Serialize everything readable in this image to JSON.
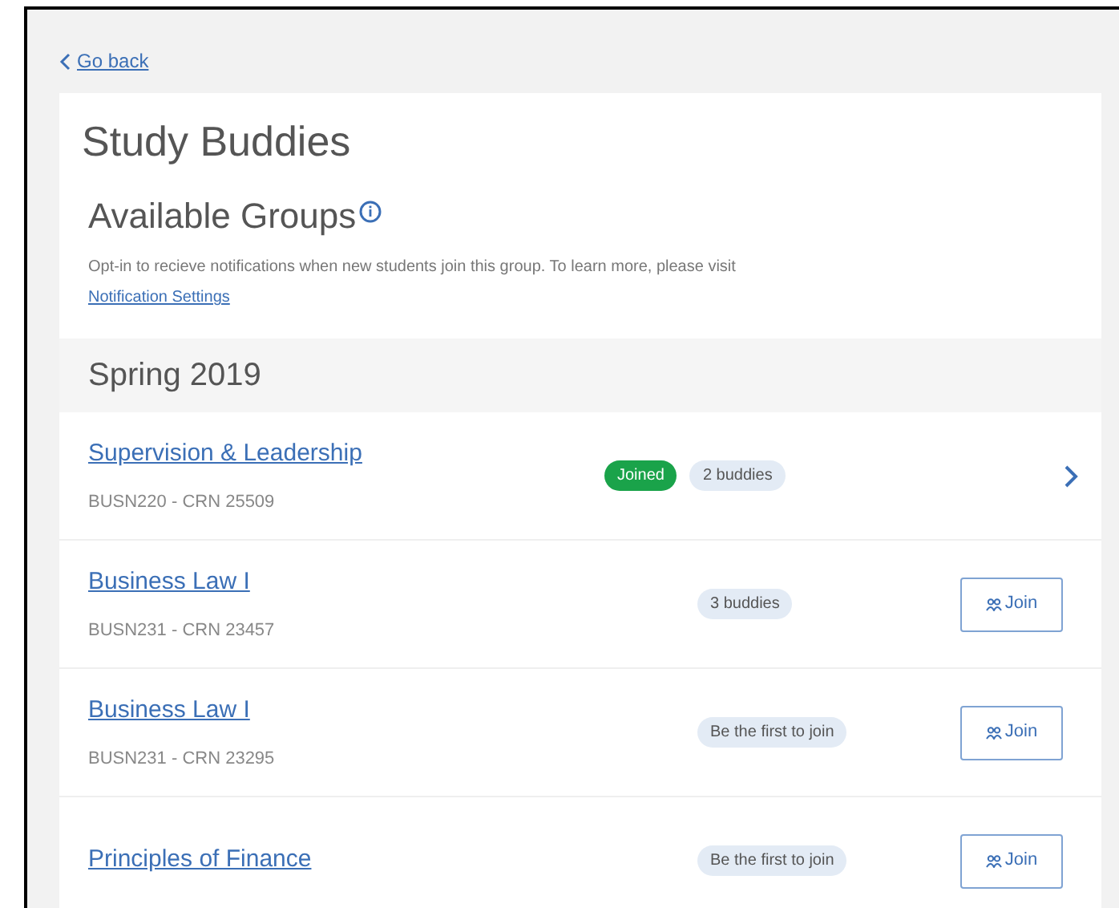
{
  "back_link": "Go back",
  "title": "Study Buddies",
  "section": {
    "heading": "Available Groups",
    "description": "Opt-in to recieve notifications when new students join this group. To learn more, please visit",
    "link": "Notification Settings"
  },
  "term": "Spring 2019",
  "groups": [
    {
      "name": "Supervision & Leadership",
      "code": "BUSN220 - CRN 25509",
      "joined": true,
      "joined_label": "Joined",
      "buddies": "2 buddies"
    },
    {
      "name": "Business Law I",
      "code": "BUSN231 - CRN 23457",
      "joined": false,
      "buddies": "3 buddies",
      "action": "Join"
    },
    {
      "name": "Business Law I",
      "code": "BUSN231 - CRN 23295",
      "joined": false,
      "buddies": "Be the first to join",
      "action": "Join"
    },
    {
      "name": "Principles of Finance",
      "joined": false,
      "buddies": "Be the first to join",
      "action": "Join"
    }
  ]
}
